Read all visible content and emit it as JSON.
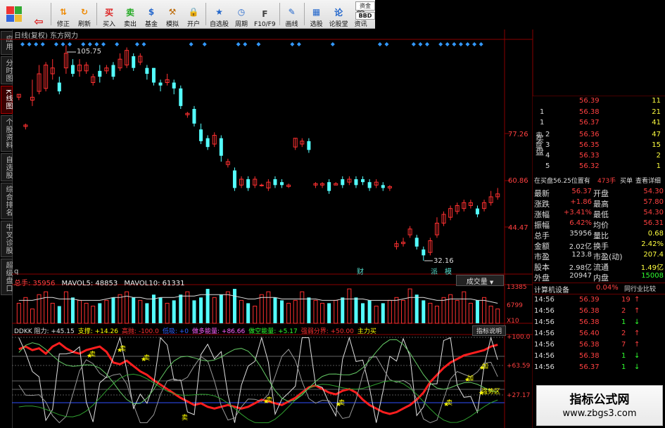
{
  "toolbar": {
    "buttons": [
      {
        "label": "",
        "icon": "back-arrow-icon"
      },
      {
        "label": "修正",
        "icon": "up-down-arrows-icon"
      },
      {
        "label": "刷新",
        "icon": "refresh-icon"
      },
      {
        "label": "买入",
        "icon": "buy-icon",
        "glyph": "买"
      },
      {
        "label": "卖出",
        "icon": "sell-icon",
        "glyph": "卖"
      },
      {
        "label": "基金",
        "icon": "fund-icon",
        "glyph": "$"
      },
      {
        "label": "模拟",
        "icon": "hammer-icon",
        "glyph": "⚒"
      },
      {
        "label": "开户",
        "icon": "lock-icon",
        "glyph": "🔒"
      },
      {
        "label": "自选股",
        "icon": "watchlist-icon",
        "glyph": "★"
      },
      {
        "label": "周期",
        "icon": "clock-icon",
        "glyph": "◷"
      },
      {
        "label": "F10/F9",
        "icon": "f10-icon",
        "glyph": "F"
      },
      {
        "label": "画线",
        "icon": "pen-icon",
        "glyph": "✎"
      },
      {
        "label": "选股",
        "icon": "screen-icon",
        "glyph": "▦"
      },
      {
        "label": "论股堂",
        "icon": "forum-icon",
        "glyph": "论"
      },
      {
        "label": "资讯",
        "icon": "news-icon",
        "glyph": "资"
      }
    ],
    "right_top": "资金",
    "right_bottom": "BBD"
  },
  "sidebar": [
    {
      "label": "应用"
    },
    {
      "label": "分时图"
    },
    {
      "label": "K线图"
    },
    {
      "label": "个股资料"
    },
    {
      "label": "自选股"
    },
    {
      "label": "综合排名"
    },
    {
      "label": "牛叉诊股"
    },
    {
      "label": "超级盘口"
    }
  ],
  "chart": {
    "title": "日线(复权)  东方网力",
    "high_label": "105.75",
    "low_label": "32.16",
    "y_ticks": [
      "77.26",
      "60.86",
      "44.47"
    ],
    "markers": [
      "财",
      "派",
      "模"
    ],
    "volume_tab": "成交量",
    "bottom_tab": "q"
  },
  "volume": {
    "legend_total": "总手: 35956",
    "legend_ma5": "MAVOL5: 48853",
    "legend_ma10": "MAVOL10: 61331",
    "y_ticks": [
      "13385",
      "6799",
      "X10"
    ]
  },
  "dokk": {
    "legend": [
      {
        "text": "DDKK 阻力: +45.15",
        "color": "#e0e0e0"
      },
      {
        "text": "支撑: +14.26",
        "color": "#ffff00"
      },
      {
        "text": "高抛: -100.0",
        "color": "#ff3030"
      },
      {
        "text": "低吸: +0",
        "color": "#3060ff"
      },
      {
        "text": "做多能量: +86.66",
        "color": "#ff60ff"
      },
      {
        "text": "做空能量: +5.17",
        "color": "#30ff30"
      },
      {
        "text": "强弱分界: +50.00",
        "color": "#ff3030"
      },
      {
        "text": "主力买",
        "color": "#ffff00"
      }
    ],
    "indicator_button": "指标说明",
    "y_ticks": [
      "+100.0",
      "+63.59",
      "+27.17"
    ],
    "signals": [
      "卖",
      "卖",
      "卖",
      "卖",
      "卖",
      "卖",
      "卖",
      "加",
      "加",
      "强势区"
    ]
  },
  "chart_data": {
    "type": "candlestick",
    "title": "日线(复权) 东方网力",
    "ylim": [
      30,
      108
    ],
    "candles": [
      {
        "o": 88,
        "c": 89,
        "h": 89,
        "l": 87
      },
      {
        "o": 78,
        "c": 78.5,
        "h": 79,
        "l": 77
      },
      {
        "o": 87,
        "c": 88,
        "h": 94,
        "l": 85
      },
      {
        "o": 90,
        "c": 96,
        "h": 99,
        "l": 89
      },
      {
        "o": 91,
        "c": 99,
        "h": 100,
        "l": 90
      },
      {
        "o": 96,
        "c": 98,
        "h": 101,
        "l": 94
      },
      {
        "o": 93,
        "c": 90,
        "h": 95,
        "l": 89
      },
      {
        "o": 98,
        "c": 103,
        "h": 105.75,
        "l": 96
      },
      {
        "o": 99,
        "c": 96,
        "h": 101,
        "l": 95
      },
      {
        "o": 97,
        "c": 99,
        "h": 101,
        "l": 95
      },
      {
        "o": 97,
        "c": 99,
        "h": 100,
        "l": 96
      },
      {
        "o": 93,
        "c": 95,
        "h": 96,
        "l": 92
      },
      {
        "o": 97,
        "c": 95,
        "h": 99,
        "l": 93
      },
      {
        "o": 97,
        "c": 98,
        "h": 99,
        "l": 96
      },
      {
        "o": 99,
        "c": 95,
        "h": 100,
        "l": 94
      },
      {
        "o": 98,
        "c": 101,
        "h": 103,
        "l": 97
      },
      {
        "o": 99,
        "c": 104,
        "h": 105,
        "l": 98
      },
      {
        "o": 102,
        "c": 98,
        "h": 103,
        "l": 97
      },
      {
        "o": 100,
        "c": 102,
        "h": 103,
        "l": 99
      },
      {
        "o": 98,
        "c": 96,
        "h": 99,
        "l": 94
      },
      {
        "o": 98,
        "c": 93,
        "h": 98,
        "l": 92
      },
      {
        "o": 93,
        "c": 92,
        "h": 94,
        "l": 90
      },
      {
        "o": 93,
        "c": 94,
        "h": 96,
        "l": 92
      },
      {
        "o": 93,
        "c": 91,
        "h": 94,
        "l": 89
      },
      {
        "o": 91,
        "c": 85,
        "h": 92,
        "l": 84
      },
      {
        "o": 82,
        "c": 82.5,
        "h": 83,
        "l": 81
      },
      {
        "o": 84,
        "c": 79,
        "h": 85,
        "l": 78
      },
      {
        "o": 77,
        "c": 73,
        "h": 79,
        "l": 72
      },
      {
        "o": 74,
        "c": 71,
        "h": 75,
        "l": 70
      },
      {
        "o": 72,
        "c": 75,
        "h": 76,
        "l": 71
      },
      {
        "o": 74,
        "c": 68,
        "h": 75,
        "l": 66
      },
      {
        "o": 65,
        "c": 66,
        "h": 67,
        "l": 64
      },
      {
        "o": 63,
        "c": 57,
        "h": 64,
        "l": 56
      },
      {
        "o": 58,
        "c": 60,
        "h": 61,
        "l": 57
      },
      {
        "o": 60,
        "c": 57,
        "h": 61,
        "l": 56
      },
      {
        "o": 58,
        "c": 60,
        "h": 61,
        "l": 57
      },
      {
        "o": 58,
        "c": 58,
        "h": 58.5,
        "l": 57.5
      },
      {
        "o": 57,
        "c": 59,
        "h": 60,
        "l": 56
      },
      {
        "o": 60,
        "c": 58,
        "h": 61,
        "l": 57
      },
      {
        "o": 59,
        "c": 58,
        "h": 60,
        "l": 57
      },
      {
        "o": 57.5,
        "c": 58,
        "h": 58.5,
        "l": 57
      },
      {
        "o": 71,
        "c": 74,
        "h": 74,
        "l": 70
      },
      {
        "o": 72,
        "c": 73,
        "h": 74,
        "l": 71
      },
      {
        "o": 73,
        "c": 70,
        "h": 74,
        "l": 69
      },
      {
        "o": 58,
        "c": 58.5,
        "h": 59,
        "l": 57
      },
      {
        "o": 58,
        "c": 58.5,
        "h": 59,
        "l": 57
      },
      {
        "o": 59,
        "c": 56,
        "h": 60,
        "l": 55
      },
      {
        "o": 58,
        "c": 58.5,
        "h": 59,
        "l": 58
      },
      {
        "o": 60,
        "c": 58,
        "h": 61,
        "l": 57
      },
      {
        "o": 59,
        "c": 60,
        "h": 61,
        "l": 58
      },
      {
        "o": 60,
        "c": 58,
        "h": 61,
        "l": 57
      },
      {
        "o": 60,
        "c": 59,
        "h": 61,
        "l": 58
      },
      {
        "o": 59,
        "c": 57,
        "h": 60,
        "l": 56
      },
      {
        "o": 58,
        "c": 59,
        "h": 60,
        "l": 57
      },
      {
        "o": 58,
        "c": 57,
        "h": 59,
        "l": 56
      },
      {
        "o": 57,
        "c": 57.5,
        "h": 58,
        "l": 56
      },
      {
        "o": 37,
        "c": 38,
        "h": 39,
        "l": 36
      },
      {
        "o": 38,
        "c": 38.5,
        "h": 40,
        "l": 37
      },
      {
        "o": 41,
        "c": 43,
        "h": 44,
        "l": 40
      },
      {
        "o": 40,
        "c": 37,
        "h": 41,
        "l": 36
      },
      {
        "o": 36,
        "c": 34,
        "h": 37,
        "l": 32.16
      },
      {
        "o": 35,
        "c": 39,
        "h": 40,
        "l": 34
      },
      {
        "o": 41,
        "c": 45,
        "h": 47,
        "l": 40
      },
      {
        "o": 45,
        "c": 48,
        "h": 49,
        "l": 44
      },
      {
        "o": 47,
        "c": 50,
        "h": 51,
        "l": 46
      },
      {
        "o": 49,
        "c": 51,
        "h": 52,
        "l": 48
      },
      {
        "o": 50,
        "c": 52,
        "h": 53,
        "l": 49
      },
      {
        "o": 51,
        "c": 52,
        "h": 53,
        "l": 50
      },
      {
        "o": 50,
        "c": 48,
        "h": 51,
        "l": 47
      },
      {
        "o": 50,
        "c": 52,
        "h": 53,
        "l": 49
      },
      {
        "o": 52,
        "c": 54,
        "h": 56,
        "l": 51
      },
      {
        "o": 54,
        "c": 55,
        "h": 57,
        "l": 53
      }
    ],
    "volume": [
      7,
      9,
      5,
      10,
      11,
      7,
      6,
      11,
      9,
      8,
      7,
      6,
      7,
      8,
      9,
      10,
      11,
      9,
      8,
      7,
      10,
      9,
      7,
      8,
      10,
      11,
      8,
      9,
      12,
      9,
      10,
      11,
      12,
      8,
      7,
      6,
      10,
      11,
      9,
      8,
      7,
      8,
      11,
      9,
      8,
      7,
      7,
      8,
      9,
      12,
      9,
      7,
      8,
      6,
      7,
      8,
      9,
      8,
      12,
      10,
      8,
      7,
      6,
      9,
      10,
      8,
      11,
      7,
      8,
      9,
      6,
      5
    ],
    "volume_ma": [
      8,
      8,
      8,
      8.5,
      9,
      9,
      8.5,
      8.5,
      8.5,
      8,
      8,
      8,
      8,
      8.5,
      9,
      9,
      9.5,
      9,
      9,
      8.5,
      8.5,
      9,
      9,
      9,
      9.5,
      9.5,
      9.5,
      10,
      10,
      10,
      10,
      10,
      9.5,
      9,
      8.5,
      8.5,
      9,
      9,
      9,
      8.5,
      8.5,
      8.5,
      8.5,
      8.5,
      8.5,
      8,
      8,
      8,
      8.5,
      8.5,
      8.5,
      8.5,
      8,
      8,
      8,
      8,
      8,
      8.5,
      9,
      9,
      9,
      8.5,
      8,
      8,
      8.5,
      8.5,
      8.5,
      8.5,
      8,
      8,
      7.5,
      7
    ],
    "volume_ylim": [
      0,
      13385
    ]
  },
  "panel": {
    "ask_label": "卖盘",
    "bid_label": "买盘",
    "asks": [
      {
        "lvl": "1",
        "price": "56.38",
        "vol": "21"
      },
      {
        "lvl": "1",
        "price": "56.37",
        "vol": "41"
      }
    ],
    "bids": [
      {
        "lvl": "2",
        "price": "56.36",
        "vol": "47"
      },
      {
        "lvl": "3",
        "price": "56.35",
        "vol": "15"
      },
      {
        "lvl": "4",
        "price": "56.33",
        "vol": "2"
      },
      {
        "lvl": "5",
        "price": "56.32",
        "vol": "1"
      }
    ],
    "ask_top": {
      "price": "56.39",
      "vol": "11"
    },
    "position_line": "在买盘56.25位置有",
    "position_vol": "473手",
    "position_action": "买单",
    "position_detail": "查看详细",
    "quote": [
      {
        "l1": "最新",
        "v1": "56.37",
        "l2": "开盘",
        "v2": "54.30"
      },
      {
        "l1": "涨跌",
        "v1": "+1.86",
        "l2": "最高",
        "v2": "57.80"
      },
      {
        "l1": "涨幅",
        "v1": "+3.41%",
        "l2": "最低",
        "v2": "54.30"
      },
      {
        "l1": "振幅",
        "v1": "6.42%",
        "l2": "均价",
        "v2": "56.31"
      },
      {
        "l1": "总手",
        "v1": "35956",
        "l2": "量比",
        "v2": "0.68"
      },
      {
        "l1": "金额",
        "v1": "2.02亿",
        "l2": "换手",
        "v2": "2.42%"
      },
      {
        "l1": "市盈",
        "v1": "123.8",
        "l2": "市盈(动)",
        "v2": "207.4"
      },
      {
        "l1": "股本",
        "v1": "2.98亿",
        "l2": "流通",
        "v2": "1.49亿"
      },
      {
        "l1": "外盘",
        "v1": "20947",
        "l2": "内盘",
        "v2": "15008"
      }
    ],
    "industry": "计算机设备",
    "industry_pct": "0.04%",
    "industry_compare": "同行业比较",
    "ticks": [
      {
        "time": "14:56",
        "price": "56.39",
        "vol": "19",
        "dir": "up"
      },
      {
        "time": "14:56",
        "price": "56.38",
        "vol": "2",
        "dir": "up"
      },
      {
        "time": "14:56",
        "price": "56.38",
        "vol": "1",
        "dir": "down"
      },
      {
        "time": "14:56",
        "price": "56.40",
        "vol": "2",
        "dir": "up"
      },
      {
        "time": "14:56",
        "price": "56.38",
        "vol": "7",
        "dir": "up"
      },
      {
        "time": "14:56",
        "price": "56.38",
        "vol": "1",
        "dir": "down"
      },
      {
        "time": "14:56",
        "price": "56.37",
        "vol": "1",
        "dir": "down"
      }
    ]
  },
  "watermark": {
    "line1": "指标公式网",
    "line2": "www.zbgs3.com"
  }
}
